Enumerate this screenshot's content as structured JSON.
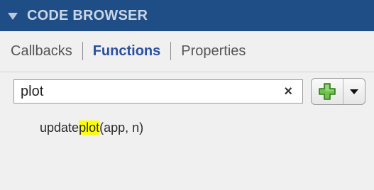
{
  "header": {
    "title": "CODE BROWSER",
    "collapse_icon": "triangle-down-icon"
  },
  "tabs": [
    {
      "label": "Callbacks",
      "active": false
    },
    {
      "label": "Functions",
      "active": true
    },
    {
      "label": "Properties",
      "active": false
    }
  ],
  "search": {
    "value": "plot",
    "placeholder": "",
    "clear_icon": "close-icon",
    "clear_glyph": "×"
  },
  "add_button": {
    "icon": "plus-icon",
    "dropdown_icon": "chevron-down-icon"
  },
  "results": [
    {
      "prefix": "update",
      "match": "plot",
      "suffix": "(app, n)"
    }
  ],
  "colors": {
    "header_bg": "#1f4d85",
    "active_tab": "#2a4fa0",
    "match_highlight": "#ffff00",
    "plus_fill": "#6cc24a"
  }
}
